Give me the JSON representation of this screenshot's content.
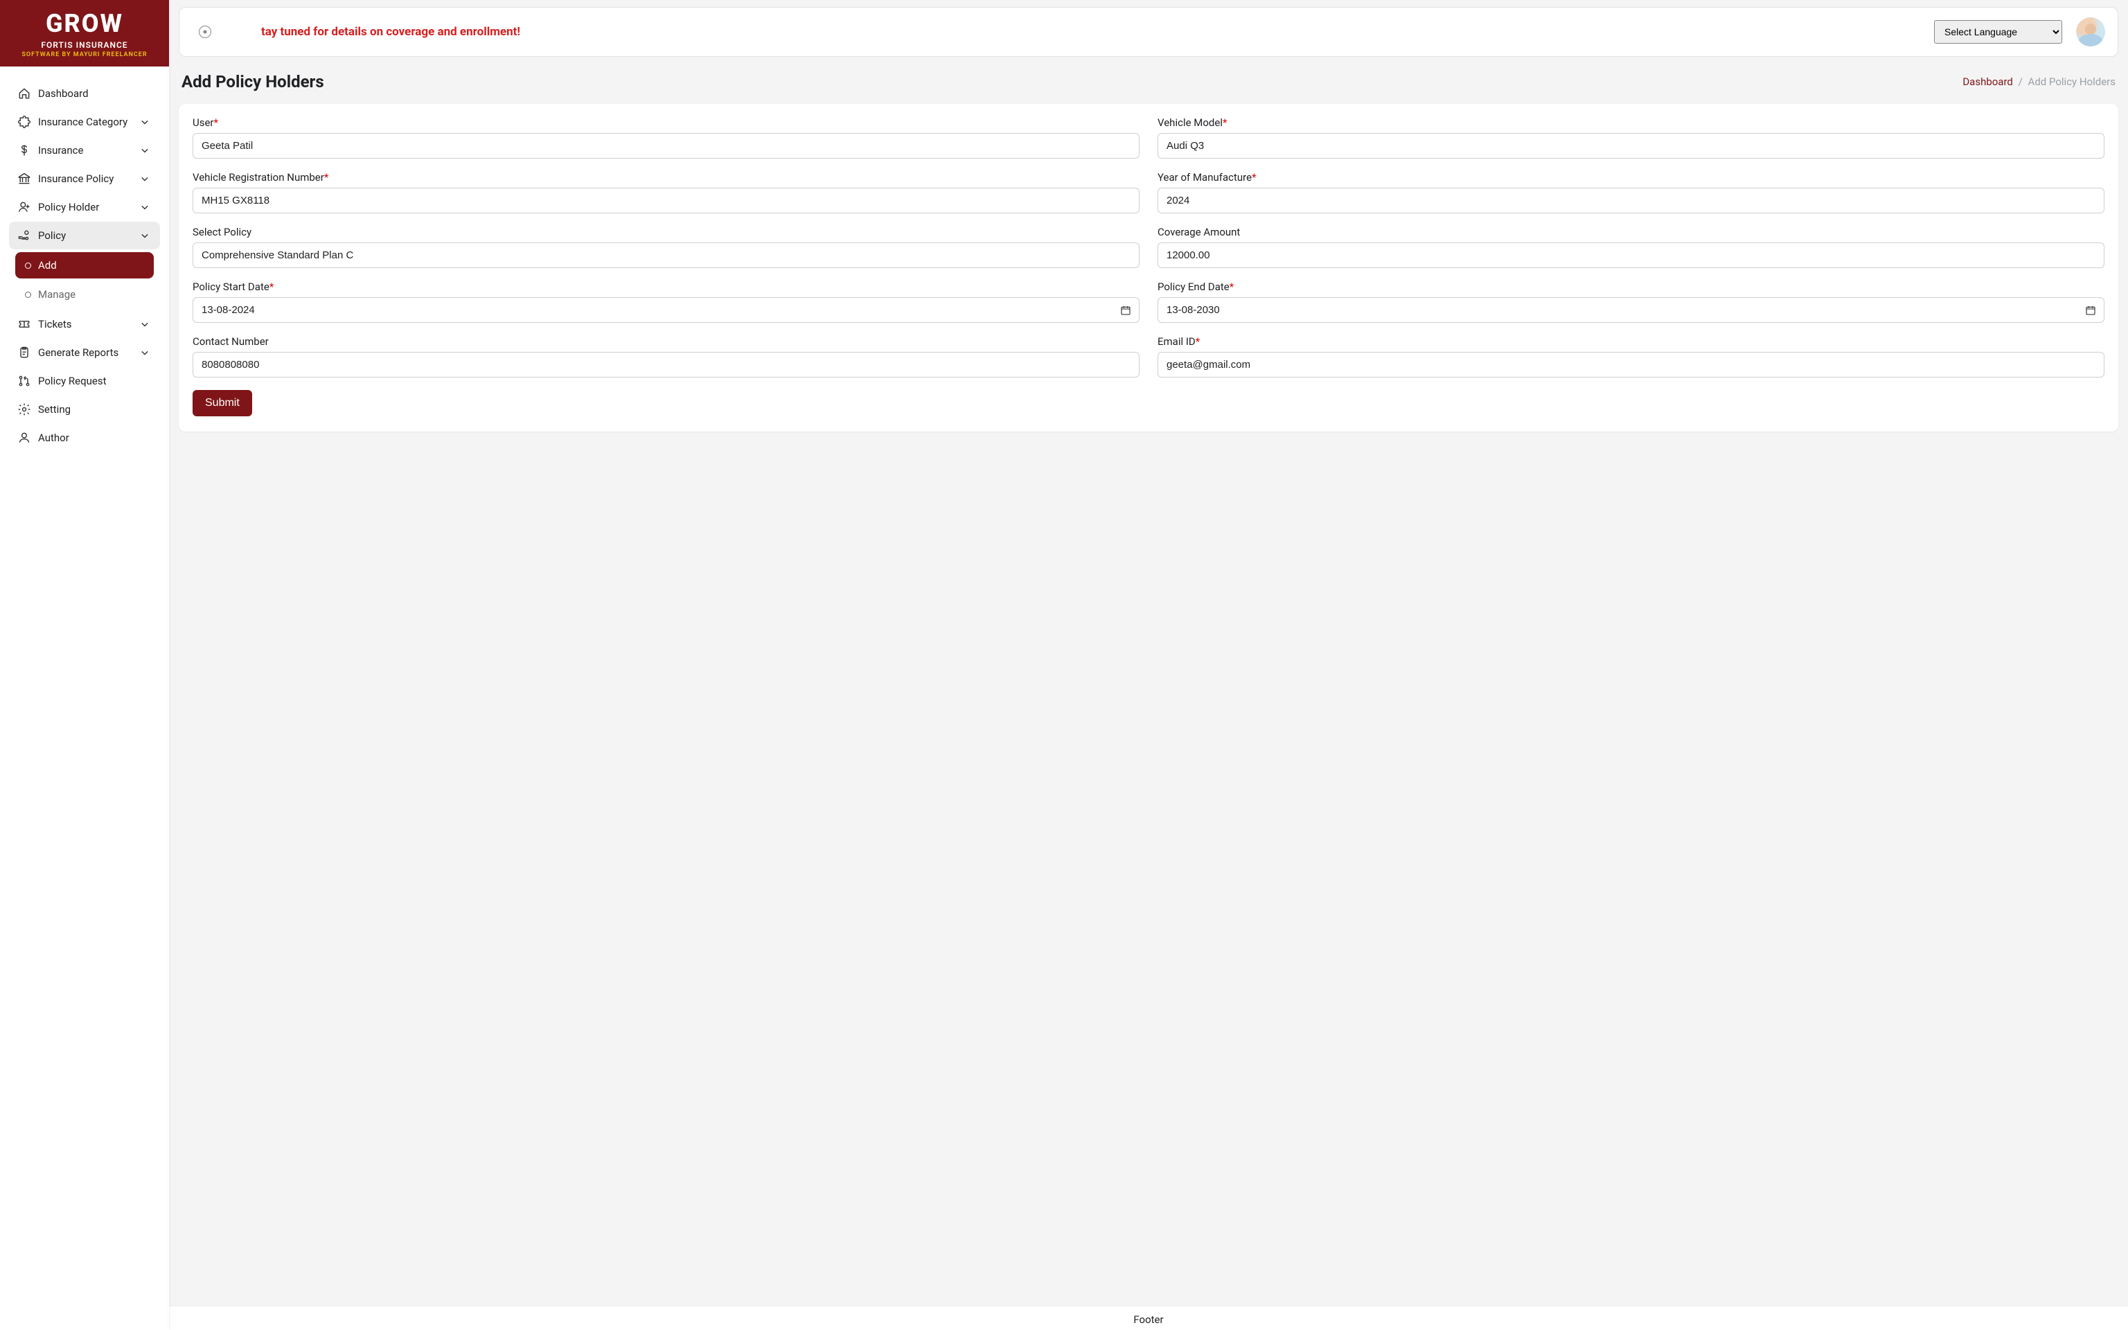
{
  "brand": {
    "logo_text": "GROW",
    "subtitle1": "FORTIS INSURANCE",
    "subtitle2": "SOFTWARE BY MAYURI FREELANCER"
  },
  "sidebar": {
    "items": [
      {
        "label": "Dashboard",
        "icon": "home-icon",
        "expandable": false
      },
      {
        "label": "Insurance Category",
        "icon": "puzzle-icon",
        "expandable": true
      },
      {
        "label": "Insurance",
        "icon": "dollar-icon",
        "expandable": true
      },
      {
        "label": "Insurance Policy",
        "icon": "bank-icon",
        "expandable": true
      },
      {
        "label": "Policy Holder",
        "icon": "user-plus-icon",
        "expandable": true
      },
      {
        "label": "Policy",
        "icon": "hand-coin-icon",
        "expandable": true,
        "active": true,
        "children": [
          {
            "label": "Add",
            "active": true
          },
          {
            "label": "Manage",
            "active": false
          }
        ]
      },
      {
        "label": "Tickets",
        "icon": "ticket-icon",
        "expandable": true
      },
      {
        "label": "Generate Reports",
        "icon": "clipboard-icon",
        "expandable": true
      },
      {
        "label": "Policy Request",
        "icon": "pull-request-icon",
        "expandable": false
      },
      {
        "label": "Setting",
        "icon": "gear-icon",
        "expandable": false
      },
      {
        "label": "Author",
        "icon": "user-icon",
        "expandable": false
      }
    ]
  },
  "topbar": {
    "notice_text": "tay tuned for details on coverage and enrollment!",
    "language_placeholder": "Select Language"
  },
  "page": {
    "title": "Add Policy Holders",
    "breadcrumb_root": "Dashboard",
    "breadcrumb_current": "Add Policy Holders"
  },
  "form": {
    "labels": {
      "user": "User",
      "vehicle_model": "Vehicle Model",
      "vehicle_reg": "Vehicle Registration Number",
      "year": "Year of Manufacture",
      "select_policy": "Select Policy",
      "coverage": "Coverage Amount",
      "start_date": "Policy Start Date",
      "end_date": "Policy End Date",
      "contact": "Contact Number",
      "email": "Email ID"
    },
    "values": {
      "user": "Geeta Patil",
      "vehicle_model": "Audi Q3",
      "vehicle_reg": "MH15 GX8118",
      "year": "2024",
      "select_policy": "Comprehensive Standard Plan C",
      "coverage": "12000.00",
      "start_date": "13-08-2024",
      "end_date": "13-08-2030",
      "contact": "8080808080",
      "email": "geeta@gmail.com"
    },
    "submit_label": "Submit"
  },
  "footer": {
    "text": "Footer"
  }
}
